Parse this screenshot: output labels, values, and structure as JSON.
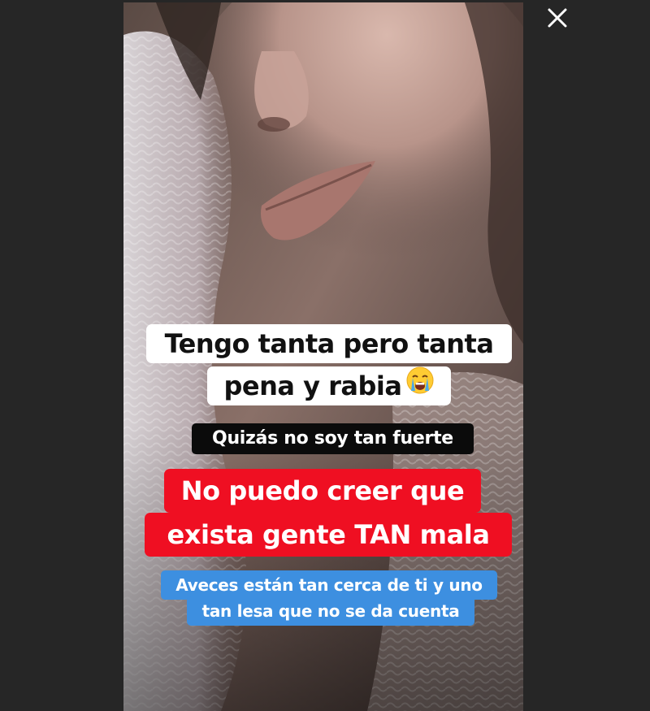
{
  "viewer": {
    "close_icon": "close-icon",
    "background_color": "#262626"
  },
  "story": {
    "image_alt": "Close-up selfie of a woman lying with her face against a knitted blanket",
    "captions": {
      "line1": "Tengo tanta pero tanta",
      "line2": "pena y rabia",
      "emoji": "loudly-crying-face-icon",
      "line3": "Quizás no soy tan fuerte",
      "line4": "No puedo creer que",
      "line5": "exista gente TAN mala",
      "line6": "Aveces están tan cerca de ti y uno",
      "line7": "tan lesa que no se da cuenta"
    },
    "colors": {
      "white_caption_bg": "#ffffff",
      "black_caption_bg": "#0b0b0b",
      "red_caption_bg": "#ef0f22",
      "blue_caption_bg": "#3d8fe0"
    }
  }
}
